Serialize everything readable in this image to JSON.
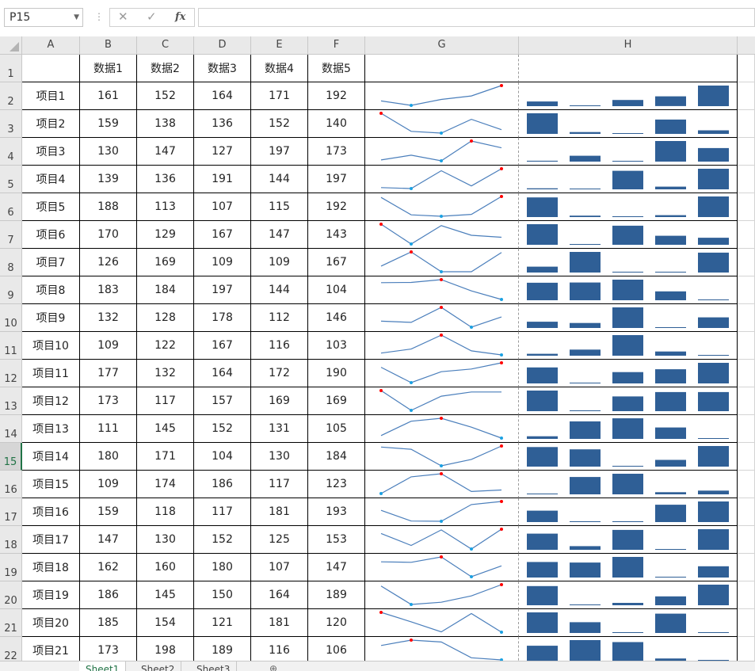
{
  "formula_bar": {
    "name_box": "P15",
    "formula": ""
  },
  "columns": [
    "A",
    "B",
    "C",
    "D",
    "E",
    "F",
    "G",
    "H"
  ],
  "rows": [
    "1",
    "2",
    "3",
    "4",
    "5",
    "6",
    "7",
    "8",
    "9",
    "10",
    "11",
    "12",
    "13",
    "14",
    "15",
    "16",
    "17",
    "18",
    "19",
    "20",
    "21",
    "22"
  ],
  "active_row": "15",
  "header_row": [
    "",
    "数据1",
    "数据2",
    "数据3",
    "数据4",
    "数据5"
  ],
  "data_rows": [
    {
      "label": "项目1",
      "values": [
        161,
        152,
        164,
        171,
        192
      ]
    },
    {
      "label": "项目2",
      "values": [
        159,
        138,
        136,
        152,
        140
      ]
    },
    {
      "label": "项目3",
      "values": [
        130,
        147,
        127,
        197,
        173
      ]
    },
    {
      "label": "项目4",
      "values": [
        139,
        136,
        191,
        144,
        197
      ]
    },
    {
      "label": "项目5",
      "values": [
        188,
        113,
        107,
        115,
        192
      ]
    },
    {
      "label": "项目6",
      "values": [
        170,
        129,
        167,
        147,
        143
      ]
    },
    {
      "label": "项目7",
      "values": [
        126,
        169,
        109,
        109,
        167
      ]
    },
    {
      "label": "项目8",
      "values": [
        183,
        184,
        197,
        144,
        104
      ]
    },
    {
      "label": "项目9",
      "values": [
        132,
        128,
        178,
        112,
        146
      ]
    },
    {
      "label": "项目10",
      "values": [
        109,
        122,
        167,
        116,
        103
      ]
    },
    {
      "label": "项目11",
      "values": [
        177,
        132,
        164,
        172,
        190
      ]
    },
    {
      "label": "项目12",
      "values": [
        173,
        117,
        157,
        169,
        169
      ]
    },
    {
      "label": "项目13",
      "values": [
        111,
        145,
        152,
        131,
        105
      ]
    },
    {
      "label": "项目14",
      "values": [
        180,
        171,
        104,
        130,
        184
      ]
    },
    {
      "label": "项目15",
      "values": [
        109,
        174,
        186,
        117,
        123
      ]
    },
    {
      "label": "项目16",
      "values": [
        159,
        118,
        117,
        181,
        193
      ]
    },
    {
      "label": "项目17",
      "values": [
        147,
        130,
        152,
        125,
        153
      ]
    },
    {
      "label": "项目18",
      "values": [
        162,
        160,
        180,
        107,
        147
      ]
    },
    {
      "label": "项目19",
      "values": [
        186,
        145,
        150,
        164,
        189
      ]
    },
    {
      "label": "项目20",
      "values": [
        185,
        154,
        121,
        181,
        120
      ]
    },
    {
      "label": "项目21",
      "values": [
        173,
        198,
        189,
        116,
        106
      ]
    }
  ],
  "sparkline_colors": {
    "line": "#4a7ebb",
    "high": "#ff0000",
    "low": "#1ba1e2",
    "column": "#2f5f96"
  },
  "sheet_tabs": [
    "Sheet1",
    "Sheet2",
    "Sheet3"
  ],
  "active_sheet": "Sheet1",
  "add_sheet_label": "⊕"
}
